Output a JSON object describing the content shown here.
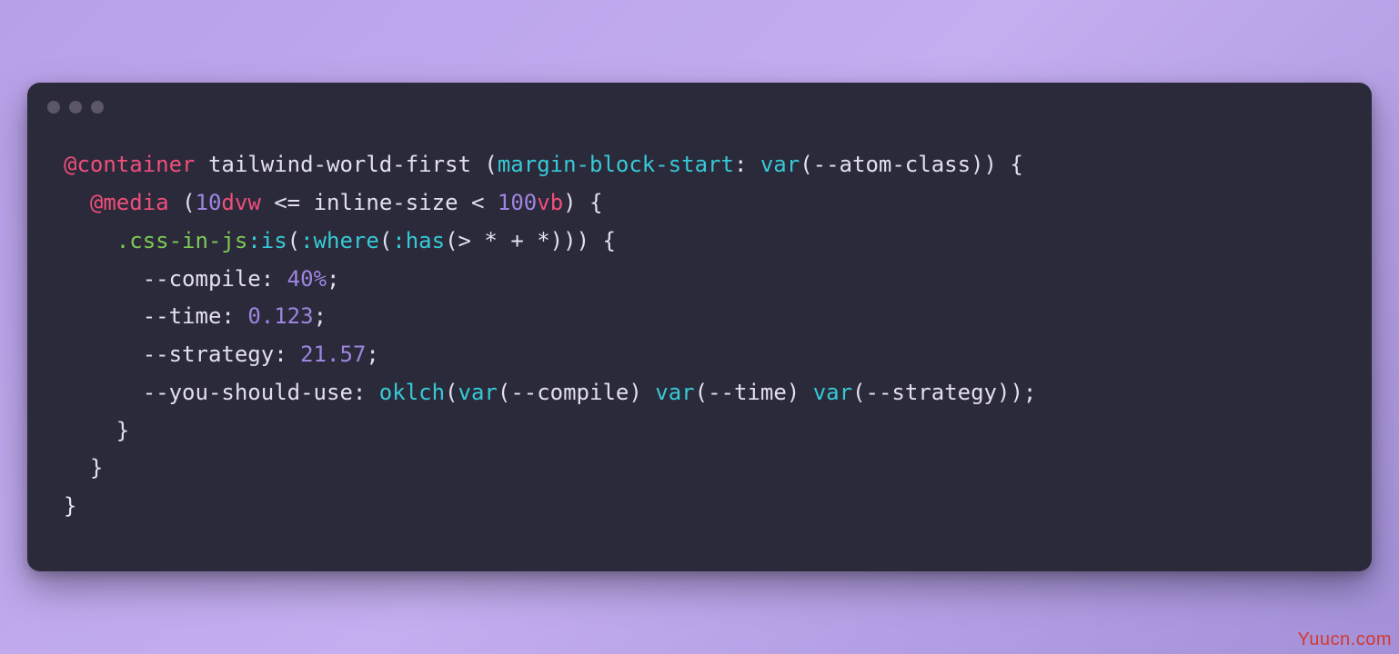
{
  "code": {
    "line1": {
      "atrule": "@container",
      "name": "tailwind-world-first",
      "open_paren": "(",
      "prop": "margin-block-start",
      "colon": ":",
      "func": "var",
      "varname": "--atom-class",
      "close_paren": ")",
      "brace": "{"
    },
    "line2": {
      "atrule": "@media",
      "open_paren": "(",
      "num1": "10",
      "unit1": "dvw",
      "op1": "<=",
      "size": "inline-size",
      "op2": "<",
      "num2": "100",
      "unit2": "vb",
      "close_paren": ")",
      "brace": "{"
    },
    "line3": {
      "selector": ".css-in-js",
      "pseudo1": ":is",
      "open1": "(",
      "pseudo2": ":where",
      "open2": "(",
      "pseudo3": ":has",
      "open3": "(",
      "combinator": "> * + *",
      "close": ")))",
      "brace": "{"
    },
    "line4": {
      "prop": "--compile",
      "colon": ":",
      "val": "40",
      "unit": "%",
      "semi": ";"
    },
    "line5": {
      "prop": "--time",
      "colon": ":",
      "val": "0.123",
      "semi": ";"
    },
    "line6": {
      "prop": "--strategy",
      "colon": ":",
      "val": "21.57",
      "semi": ";"
    },
    "line7": {
      "prop": "--you-should-use",
      "colon": ":",
      "func": "oklch",
      "open": "(",
      "v1func": "var",
      "v1open": "(",
      "v1": "--compile",
      "v1close": ")",
      "v2func": "var",
      "v2open": "(",
      "v2": "--time",
      "v2close": ")",
      "v3func": "var",
      "v3open": "(",
      "v3": "--strategy",
      "v3close": ")",
      "close": ")",
      "semi": ";"
    },
    "line8": {
      "brace": "}"
    },
    "line9": {
      "brace": "}"
    },
    "line10": {
      "brace": "}"
    }
  },
  "watermark": "Yuucn.com"
}
